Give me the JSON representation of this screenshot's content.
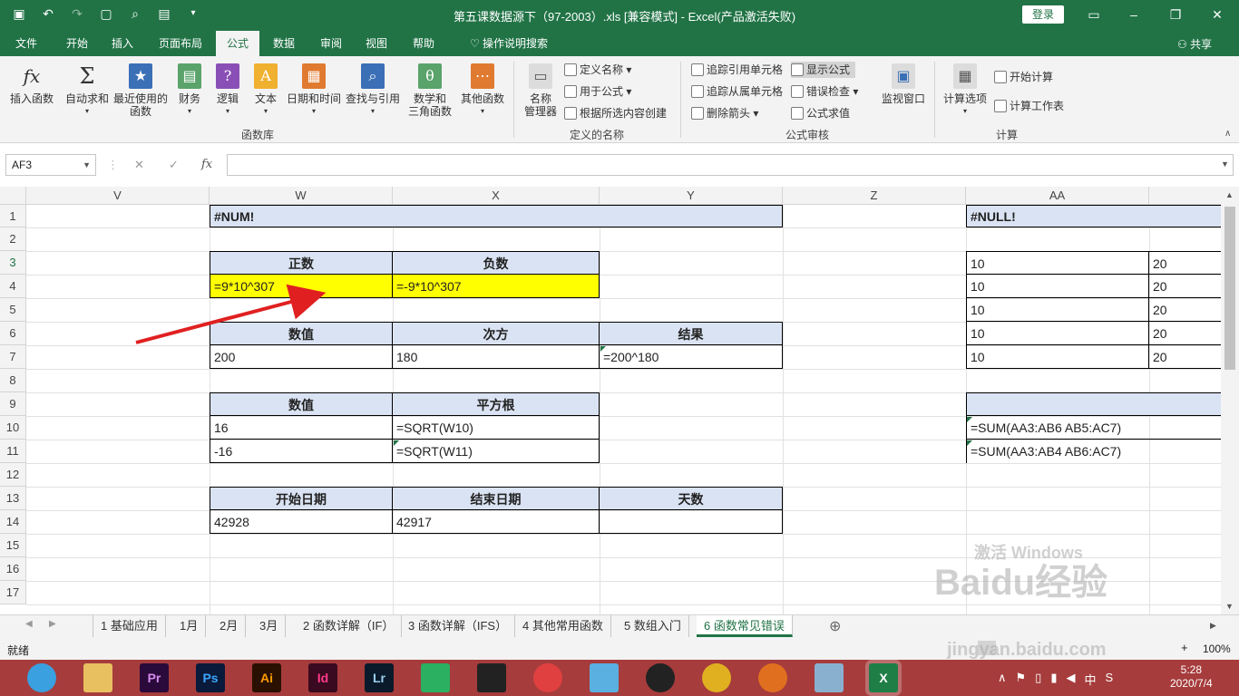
{
  "titlebar": {
    "title": "第五课数据源下（97-2003）.xls  [兼容模式]  -  Excel(产品激活失败)",
    "login": "登录",
    "qat_icons": [
      "save-icon",
      "undo-icon",
      "redo-icon",
      "new-icon",
      "print-preview-icon",
      "form-icon",
      "customize-icon"
    ]
  },
  "tabs": [
    "文件",
    "开始",
    "插入",
    "页面布局",
    "公式",
    "数据",
    "审阅",
    "视图",
    "帮助",
    "操作说明搜索"
  ],
  "active_tab": "公式",
  "share": "共享",
  "ribbon": {
    "library": {
      "insert_function": "插入函数",
      "autosum": "自动求和",
      "recent_1": "最近使用的",
      "recent_2": "函数",
      "financial": "财务",
      "logical": "逻辑",
      "text": "文本",
      "datetime": "日期和时间",
      "lookup": "查找与引用",
      "math_1": "数学和",
      "math_2": "三角函数",
      "more": "其他函数",
      "group": "函数库"
    },
    "names": {
      "manager_1": "名称",
      "manager_2": "管理器",
      "define": "定义名称",
      "use_in_formula": "用于公式",
      "create_from_sel": "根据所选内容创建",
      "group": "定义的名称"
    },
    "audit": {
      "trace_precedents": "追踪引用单元格",
      "trace_dependents": "追踪从属单元格",
      "remove_arrows": "删除箭头",
      "show_formulas": "显示公式",
      "error_check": "错误检查",
      "evaluate": "公式求值",
      "watch": "监视窗口",
      "group": "公式审核"
    },
    "calc": {
      "options": "计算选项",
      "calc_now": "开始计算",
      "calc_sheet": "计算工作表",
      "group": "计算"
    }
  },
  "formula_bar": {
    "name_box": "AF3",
    "formula": ""
  },
  "columns": [
    "V",
    "W",
    "X",
    "Y",
    "Z",
    "AA"
  ],
  "rows": [
    "1",
    "2",
    "3",
    "4",
    "5",
    "6",
    "7",
    "8",
    "9",
    "10",
    "11",
    "12",
    "13",
    "14",
    "15",
    "16",
    "17"
  ],
  "cells": {
    "num_title": "#NUM!",
    "positive_hdr": "正数",
    "negative_hdr": "负数",
    "positive_val": "=9*10^307",
    "negative_val": "=-9*10^307",
    "value_hdr_1": "数值",
    "power_hdr": "次方",
    "result_hdr": "结果",
    "value_1": "200",
    "power_1": "180",
    "result_1": "=200^180",
    "value_hdr_2": "数值",
    "sqrt_hdr": "平方根",
    "value_2": "16",
    "sqrt_2": "=SQRT(W10)",
    "value_3": "-16",
    "sqrt_3": "=SQRT(W11)",
    "start_date_hdr": "开始日期",
    "end_date_hdr": "结束日期",
    "days_hdr": "天数",
    "start_date": "42928",
    "end_date": "42917",
    "null_title": "#NULL!",
    "aa3": "10",
    "ab3": "20",
    "aa4": "10",
    "ab4": "20",
    "aa5": "10",
    "ab5": "20",
    "aa6": "10",
    "ab6": "20",
    "aa7": "10",
    "ab7": "20",
    "aa10": "=SUM(AA3:AB6 AB5:AC7)",
    "aa11": "=SUM(AA3:AB4 AB6:AC7)"
  },
  "sheets": [
    "1 基础应用",
    "1月",
    "2月",
    "3月",
    "2 函数详解（IF）",
    "3 函数详解（IFS）",
    "4 其他常用函数",
    "5 数组入门",
    "6 函数常见错误"
  ],
  "active_sheet": "6 函数常见错误",
  "status": {
    "ready": "就绪",
    "zoom": "100%"
  },
  "taskbar": {
    "apps": [
      "browser-icon",
      "file-explorer-icon",
      "premiere-icon",
      "photoshop-icon",
      "illustrator-icon",
      "indesign-icon",
      "lightroom-icon",
      "app-icon",
      "video-icon",
      "app-icon-2",
      "app-icon-3",
      "qq-icon",
      "chrome-icon",
      "app-icon-4",
      "app-icon-5",
      "excel-icon"
    ],
    "app_labels": {
      "pr": "Pr",
      "ps": "Ps",
      "ai": "Ai",
      "id": "Id",
      "lr": "Lr",
      "x": "X"
    },
    "time": "5:28",
    "date": "2020/7/4",
    "ime": "中"
  },
  "watermark": {
    "text": "Baidu经验",
    "url": "jingyan.baidu.com",
    "activate": "激活 Windows"
  },
  "colors": {
    "excel_green": "#217346",
    "header_fill": "#dae3f3",
    "highlight": "#ffff00",
    "arrow": "#e02020",
    "taskbar": "#a63c3c"
  }
}
